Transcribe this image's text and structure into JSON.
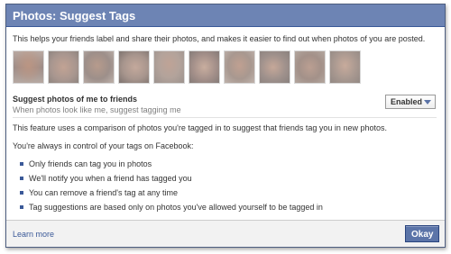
{
  "dialog": {
    "title": "Photos: Suggest Tags",
    "intro": "This helps your friends label and share their photos, and makes it easier to find out when photos of you are posted."
  },
  "thumbnails": [
    {
      "name": "photo-thumbnail-1"
    },
    {
      "name": "photo-thumbnail-2"
    },
    {
      "name": "photo-thumbnail-3"
    },
    {
      "name": "photo-thumbnail-4"
    },
    {
      "name": "photo-thumbnail-5"
    },
    {
      "name": "photo-thumbnail-6"
    },
    {
      "name": "photo-thumbnail-7"
    },
    {
      "name": "photo-thumbnail-8"
    },
    {
      "name": "photo-thumbnail-9"
    },
    {
      "name": "photo-thumbnail-10"
    }
  ],
  "setting": {
    "label": "Suggest photos of me to friends",
    "sublabel": "When photos look like me, suggest tagging me",
    "selected": "Enabled"
  },
  "body": {
    "description": "This feature uses a comparison of photos you're tagged in to suggest that friends tag you in new photos.",
    "control_text": "You're always in control of your tags on Facebook:",
    "bullets": [
      "Only friends can tag you in photos",
      "We'll notify you when a friend has tagged you",
      "You can remove a friend's tag at any time",
      "Tag suggestions are based only on photos you've allowed yourself to be tagged in"
    ]
  },
  "footer": {
    "learn_more": "Learn more",
    "okay_label": "Okay"
  },
  "colors": {
    "title_bar": "#6d84b4",
    "accent": "#3b5998",
    "button": "#5b74a8"
  }
}
